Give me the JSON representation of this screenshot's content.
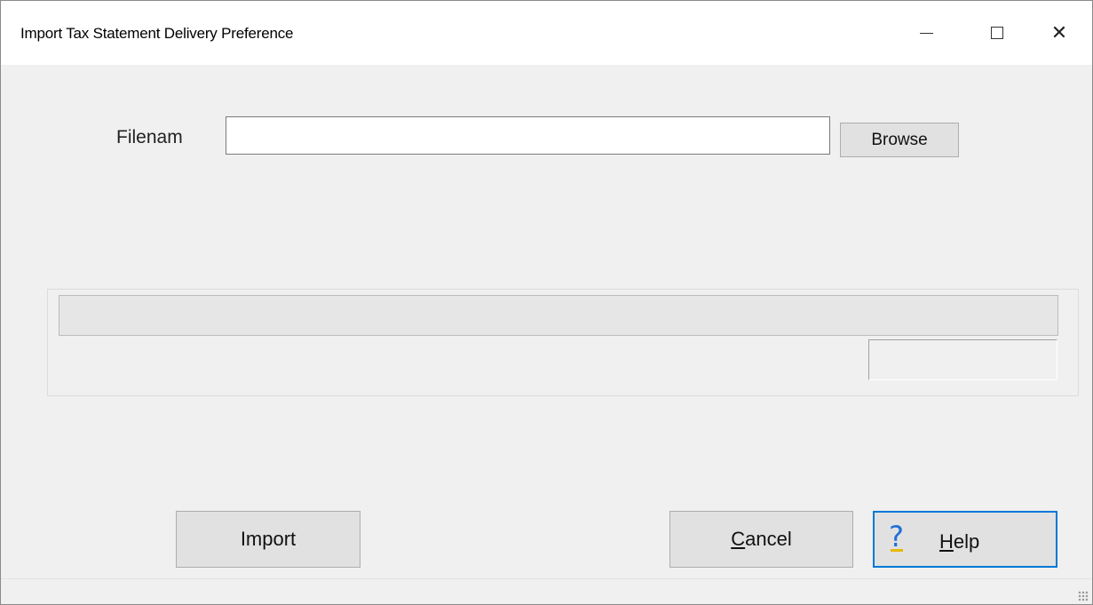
{
  "window": {
    "title": "Import Tax Statement Delivery Preference",
    "controls": {
      "minimize": "minimize-icon",
      "maximize": "maximize-icon",
      "close": "close-icon",
      "close_glyph": "✕"
    }
  },
  "form": {
    "filename_label": "Filenam",
    "filename_value": "",
    "browse_label": "Browse"
  },
  "progress": {
    "value": 0,
    "percent_text": ""
  },
  "buttons": {
    "import_label": "Import",
    "cancel_label_mnemonic": "C",
    "cancel_label_rest": "ancel",
    "help_icon_glyph": "?",
    "help_label_mnemonic": "H",
    "help_label_rest": "elp"
  },
  "colors": {
    "accent": "#0078d7",
    "help_icon": "#1e6fd9"
  }
}
